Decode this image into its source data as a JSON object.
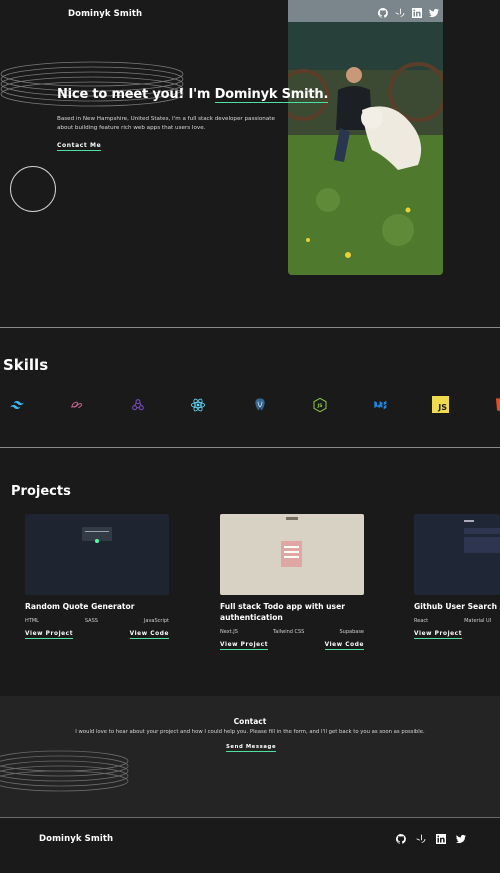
{
  "header": {
    "brand": "Dominyk Smith",
    "social": [
      "github-icon",
      "frontend-mentor-icon",
      "linkedin-icon",
      "twitter-icon"
    ]
  },
  "hero": {
    "greeting": "Nice to meet you! I'm ",
    "name": "Dominyk Smith.",
    "description": "Based in New Hampshire, United States, I'm a full stack developer passionate about building feature rich web apps that users love.",
    "contact_label": "Contact Me"
  },
  "skills": {
    "title": "Skills",
    "icons": [
      "tailwind-icon",
      "sass-icon",
      "redux-icon",
      "react-icon",
      "postgresql-icon",
      "nodejs-icon",
      "mui-icon",
      "javascript-icon",
      "html-icon"
    ],
    "js_label": "JS"
  },
  "projects": {
    "title": "Projects",
    "items": [
      {
        "title": "Random Quote Generator",
        "tags": [
          "HTML",
          "SASS",
          "JavaScript"
        ],
        "view_project": "View Project",
        "view_code": "View Code"
      },
      {
        "title": "Full stack Todo app with user authentication",
        "tags": [
          "Next.JS",
          "Tailwind CSS",
          "Supabase"
        ],
        "view_project": "View Project",
        "view_code": "View Code"
      },
      {
        "title": "Github User Search A",
        "tags": [
          "React",
          "Material UI"
        ],
        "view_project": "View Project"
      }
    ]
  },
  "contact": {
    "title": "Contact",
    "text": "I would love to hear about your project and how I could help you. Please fill in the form, and I'll get back to you as soon as possible.",
    "send_label": "Send Message"
  },
  "footer": {
    "brand": "Dominyk Smith",
    "social": [
      "github-icon",
      "frontend-mentor-icon",
      "linkedin-icon",
      "twitter-icon"
    ]
  },
  "colors": {
    "background": "#1a1a1a",
    "contact_bg": "#242424",
    "accent": "#4ee1a0"
  }
}
